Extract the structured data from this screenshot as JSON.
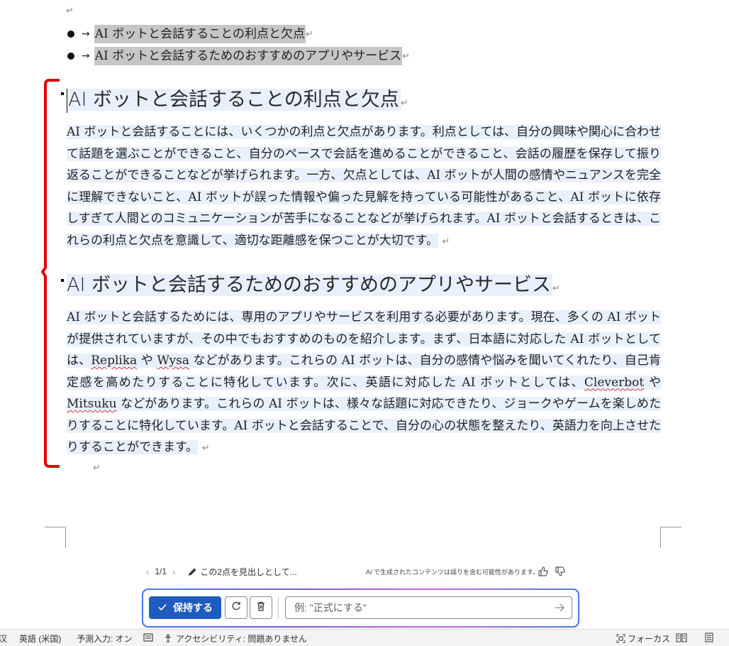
{
  "document": {
    "paragraph_mark": "↵",
    "bullets": [
      {
        "arrow": "→",
        "text": "AI ボットと会話することの利点と欠点"
      },
      {
        "arrow": "→",
        "text": "AI ボットと会話するためのおすすめのアプリやサービス"
      }
    ],
    "section1": {
      "heading": "AI ボットと会話することの利点と欠点",
      "body": "AI ボットと会話することには、いくつかの利点と欠点があります。利点としては、自分の興味や関心に合わせて話題を選ぶことができること、自分のペースで会話を進めることができること、会話の履歴を保存して振り返ることができることなどが挙げられます。一方、欠点としては、AI ボットが人間の感情やニュアンスを完全に理解できないこと、AI ボットが誤った情報や偏った見解を持っている可能性があること、AI ボットに依存しすぎて人間とのコミュニケーションが苦手になることなどが挙げられます。AI ボットと会話するときは、これらの利点と欠点を意識して、適切な距離感を保つことが大切です。"
    },
    "section2": {
      "heading": "AI ボットと会話するためのおすすめのアプリやサービス",
      "body": {
        "p1": "AI ボットと会話するためには、専用のアプリやサービスを利用する必要があります。現在、多くの AI ボットが提供されていますが、その中でもおすすめのものを紹介します。まず、日本語に対応した AI ボットとしては、",
        "replika": "Replika",
        "p2": " や ",
        "wysa": "Wysa",
        "p3": " などがあります。これらの AI ボットは、自分の感情や悩みを聞いてくれたり、自己肯定感を高めたりすることに特化しています。次に、英語に対応した AI ボットとしては、",
        "cleverbot": "Cleverbot",
        "p4": " や ",
        "mitsuku": "Mitsuku",
        "p5": " などがあります。これらの AI ボットは、様々な話題に対応できたり、ジョークやゲームを楽しめたりすることに特化しています。AI ボットと会話することで、自分の心の状態を整えたり、英語力を向上させたりすることができます。"
      }
    }
  },
  "copilot": {
    "page_prev": "‹",
    "page_count": "1/1",
    "page_next": "›",
    "suggestion": "この2点を見出しとして...",
    "disclaimer": "AI で生成されたコンテンツは誤りを含む可能性があります。",
    "keep_label": "保持する",
    "input_placeholder": "例: \"正式にする\""
  },
  "statusbar": {
    "left_cut": "汉",
    "language": "英語 (米国)",
    "predictive": "予測入力: オン",
    "accessibility": "アクセシビリティ: 問題ありません",
    "focus": "フォーカス"
  },
  "colors": {
    "selection": "#c6c6c6",
    "highlight": "#e8f0fe",
    "bracket": "#e00000",
    "accent": "#1f5bbf",
    "spellcheck": "#d13438"
  }
}
